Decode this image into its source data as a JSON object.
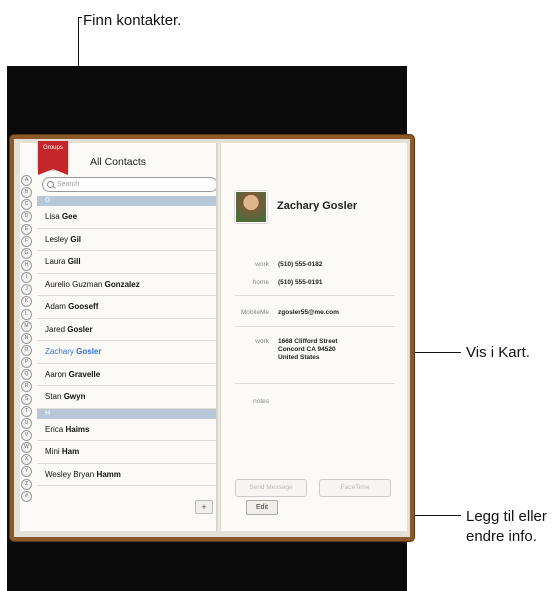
{
  "callouts": {
    "top": "Finn kontakter.",
    "map": "Vis i Kart.",
    "edit_line1": "Legg til eller",
    "edit_line2": "endre info."
  },
  "left_page": {
    "groups_label": "Groups",
    "title": "All Contacts",
    "search_placeholder": "Search",
    "index_letters": [
      "A",
      "B",
      "C",
      "D",
      "E",
      "F",
      "G",
      "H",
      "I",
      "J",
      "K",
      "L",
      "M",
      "N",
      "O",
      "P",
      "Q",
      "R",
      "S",
      "T",
      "U",
      "V",
      "W",
      "X",
      "Y",
      "Z",
      "#"
    ],
    "section_g": "G",
    "section_h": "H",
    "contacts_g": [
      {
        "first": "Lisa",
        "last": "Gee"
      },
      {
        "first": "Lesley",
        "last": "Gil"
      },
      {
        "first": "Laura",
        "last": "Gill"
      },
      {
        "first": "Aurelio Guzman",
        "last": "Gonzalez"
      },
      {
        "first": "Adam",
        "last": "Gooseff"
      },
      {
        "first": "Jared",
        "last": "Gosler"
      },
      {
        "first": "Zachary",
        "last": "Gosler"
      },
      {
        "first": "Aaron",
        "last": "Gravelle"
      },
      {
        "first": "Stan",
        "last": "Gwyn"
      }
    ],
    "contacts_h": [
      {
        "first": "Erica",
        "last": "Haims"
      },
      {
        "first": "Mini",
        "last": "Ham"
      },
      {
        "first": "Wesley Bryan",
        "last": "Hamm"
      }
    ],
    "add_label": "+"
  },
  "right_page": {
    "name": "Zachary Gosler",
    "fields": {
      "work_phone_label": "work",
      "work_phone": "(510) 555-0182",
      "home_phone_label": "home",
      "home_phone": "(510) 555-0191",
      "email_label": "MobileMe",
      "email": "zgosler55@me.com",
      "address_label": "work",
      "address_line1": "1668 Clifford Street",
      "address_line2": "Concord CA 94520",
      "address_line3": "United States",
      "notes_label": "notes"
    },
    "send_message": "Send Message",
    "facetime": "FaceTime",
    "edit_label": "Edit"
  }
}
